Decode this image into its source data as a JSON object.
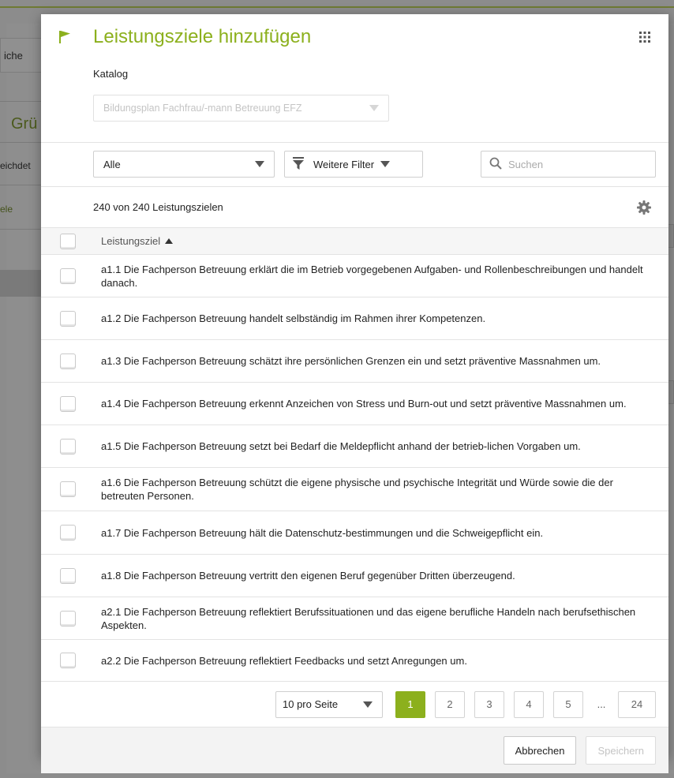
{
  "background": {
    "tab_label": "iche",
    "section_title": "Grü",
    "label_1": "eichdet",
    "link_1": "ele"
  },
  "modal": {
    "title": "Leistungsziele hinzufügen",
    "katalog_label": "Katalog",
    "katalog_value": "Bildungsplan Fachfrau/-mann Betreuung EFZ",
    "filter_select_value": "Alle",
    "more_filters_label": "Weitere Filter",
    "search_placeholder": "Suchen",
    "count_text": "240 von 240 Leistungszielen",
    "column_header": "Leistungsziel",
    "rows": [
      {
        "text": "a1.1 Die Fachperson Betreuung erklärt die im Betrieb vorgegebenen Aufgaben- und Rollenbeschreibungen und handelt danach."
      },
      {
        "text": "a1.2 Die Fachperson Betreuung handelt selbständig im Rahmen ihrer Kompetenzen."
      },
      {
        "text": "a1.3 Die Fachperson Betreuung schätzt ihre persönlichen Grenzen ein und setzt präventive Massnahmen um."
      },
      {
        "text": "a1.4 Die Fachperson Betreuung erkennt Anzeichen von Stress und Burn-out und setzt präventive Massnahmen um."
      },
      {
        "text": "a1.5 Die Fachperson Betreuung setzt bei Bedarf die Meldepflicht anhand der betrieb-lichen Vorgaben um."
      },
      {
        "text": "a1.6 Die Fachperson Betreuung schützt die eigene physische und psychische Integrität und Würde sowie die der betreuten Personen."
      },
      {
        "text": "a1.7 Die Fachperson Betreuung hält die Datenschutz-bestimmungen und die Schweigepflicht ein."
      },
      {
        "text": "a1.8 Die Fachperson Betreuung vertritt den eigenen Beruf gegenüber Dritten überzeugend."
      },
      {
        "text": "a2.1 Die Fachperson Betreuung reflektiert Berufssituationen und das eigene berufliche Handeln nach berufsethischen Aspekten."
      },
      {
        "text": "a2.2 Die Fachperson Betreuung reflektiert Feedbacks und setzt Anregungen um."
      }
    ],
    "per_page_value": "10 pro Seite",
    "pages": [
      "1",
      "2",
      "3",
      "4",
      "5"
    ],
    "ellipsis": "...",
    "last_page": "24",
    "cancel_label": "Abbrechen",
    "save_label": "Speichern",
    "colors": {
      "accent": "#8cb01d",
      "title": "#8cb01d"
    },
    "icons": {
      "header": "flag-icon",
      "menu": "apps-grid-icon",
      "search": "search-icon",
      "filter": "funnel-icon",
      "settings": "gear-icon"
    }
  }
}
